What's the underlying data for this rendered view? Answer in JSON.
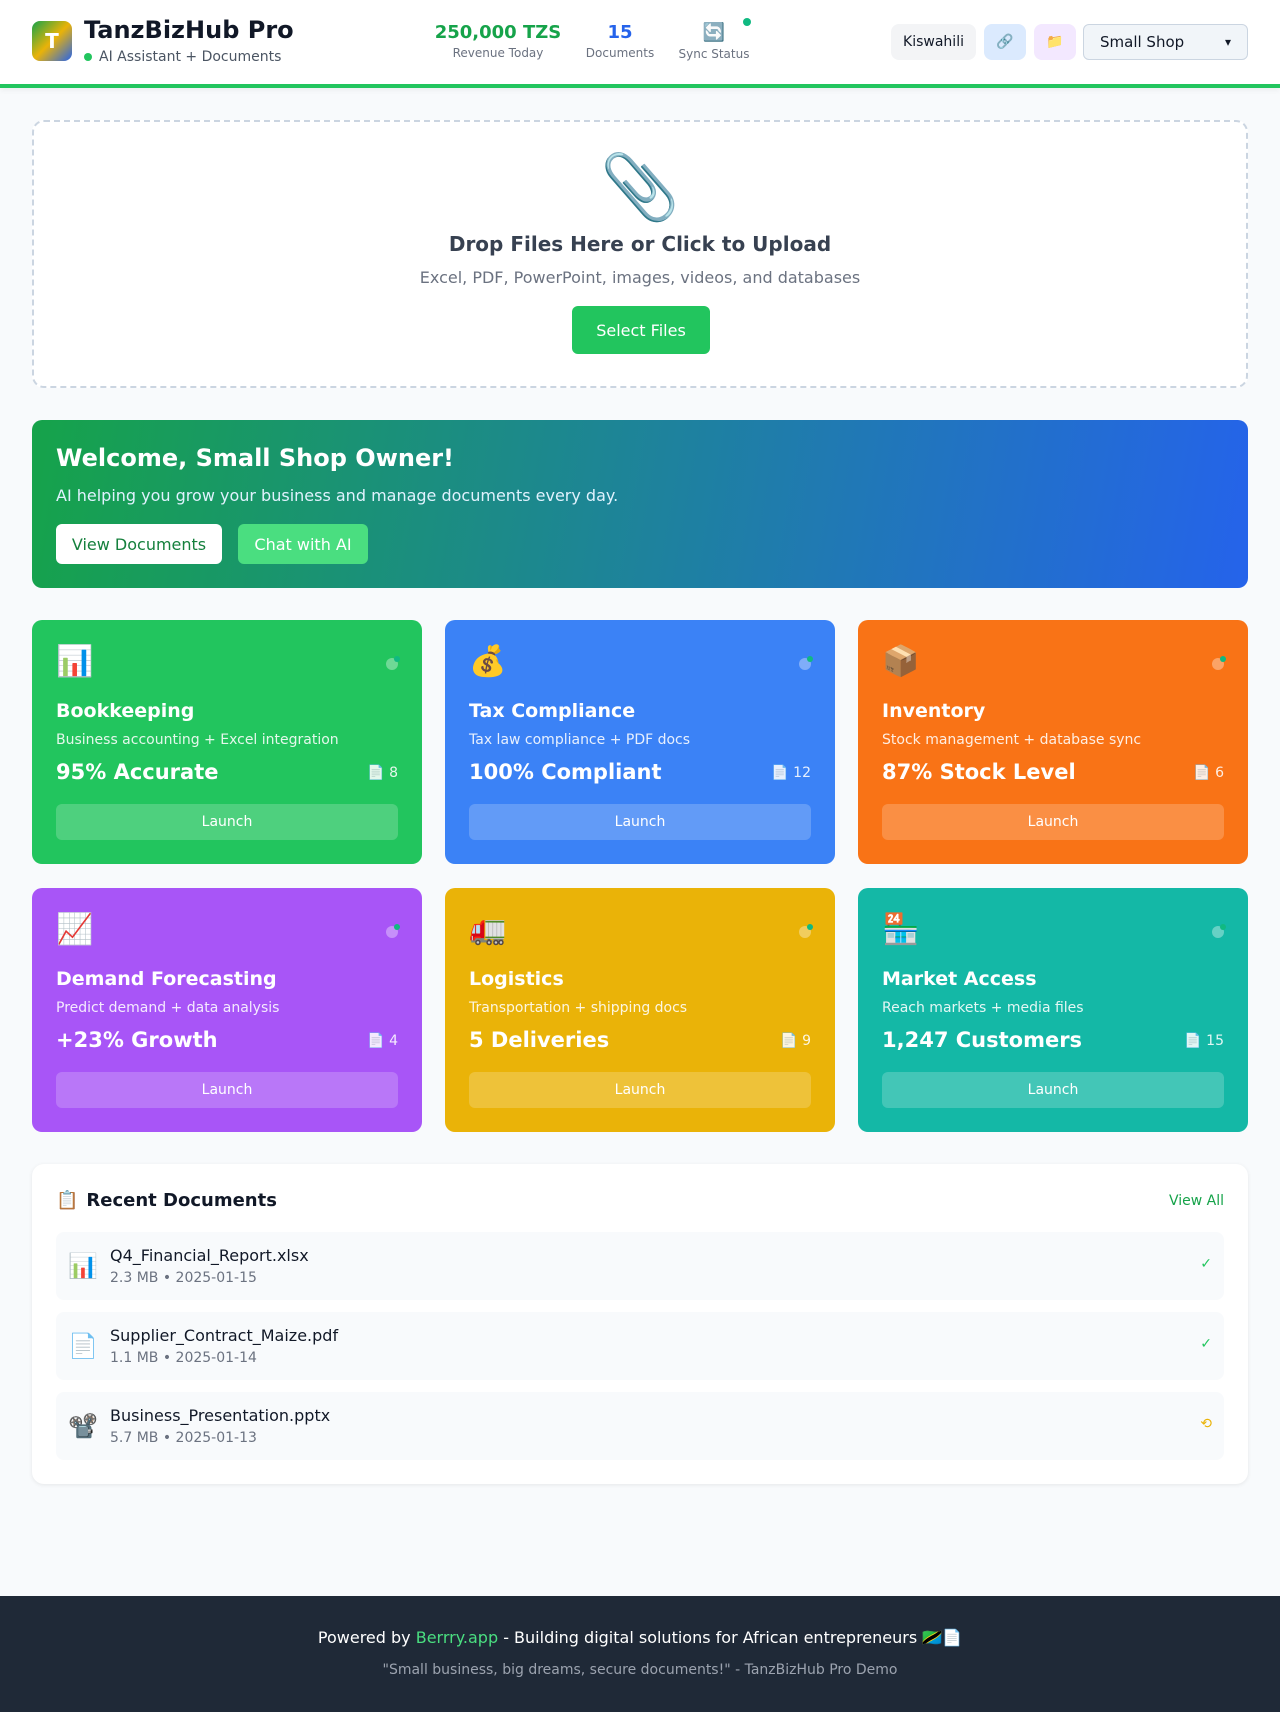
{
  "header": {
    "logo_letter": "T",
    "title": "TanzBizHub Pro",
    "subtitle": "AI Assistant + Documents",
    "stats": {
      "revenue_value": "250,000 TZS",
      "revenue_label": "Revenue Today",
      "documents_value": "15",
      "documents_label": "Documents",
      "sync_icon": "🔄",
      "sync_label": "Sync Status"
    },
    "language_button": "Kiswahili",
    "link_icon": "🔗",
    "folder_icon": "📁",
    "business_type_selected": "Small Shop"
  },
  "upload": {
    "icon": "📎",
    "title": "Drop Files Here or Click to Upload",
    "description": "Excel, PDF, PowerPoint, images, videos, and databases",
    "button": "Select Files"
  },
  "welcome": {
    "title": "Welcome, Small Shop Owner!",
    "description": "AI helping you grow your business and manage documents every day.",
    "primary_button": "View Documents",
    "secondary_button": "Chat with AI"
  },
  "cards": [
    {
      "icon": "📊",
      "title": "Bookkeeping",
      "description": "Business accounting + Excel integration",
      "metric": "95% Accurate",
      "docs": "📄 8",
      "button": "Launch",
      "color": "#22c55e"
    },
    {
      "icon": "💰",
      "title": "Tax Compliance",
      "description": "Tax law compliance + PDF docs",
      "metric": "100% Compliant",
      "docs": "📄 12",
      "button": "Launch",
      "color": "#3b82f6"
    },
    {
      "icon": "📦",
      "title": "Inventory",
      "description": "Stock management + database sync",
      "metric": "87% Stock Level",
      "docs": "📄 6",
      "button": "Launch",
      "color": "#f97316"
    },
    {
      "icon": "📈",
      "title": "Demand Forecasting",
      "description": "Predict demand + data analysis",
      "metric": "+23% Growth",
      "docs": "📄 4",
      "button": "Launch",
      "color": "#a855f7"
    },
    {
      "icon": "🚛",
      "title": "Logistics",
      "description": "Transportation + shipping docs",
      "metric": "5 Deliveries",
      "docs": "📄 9",
      "button": "Launch",
      "color": "#eab308"
    },
    {
      "icon": "🏪",
      "title": "Market Access",
      "description": "Reach markets + media files",
      "metric": "1,247 Customers",
      "docs": "📄 15",
      "button": "Launch",
      "color": "#14b8a6"
    }
  ],
  "recent": {
    "icon": "📋",
    "title": "Recent Documents",
    "view_all": "View All",
    "documents": [
      {
        "icon": "📊",
        "name": "Q4_Financial_Report.xlsx",
        "meta": "2.3 MB • 2025-01-15",
        "status": "✓"
      },
      {
        "icon": "📄",
        "name": "Supplier_Contract_Maize.pdf",
        "meta": "1.1 MB • 2025-01-14",
        "status": "✓"
      },
      {
        "icon": "📽️",
        "name": "Business_Presentation.pptx",
        "meta": "5.7 MB • 2025-01-13",
        "status": "⟲"
      }
    ]
  },
  "footer": {
    "prefix": "Powered by ",
    "brand": "Berrry.app",
    "suffix": " - Building digital solutions for African entrepreneurs 🇹🇿📄",
    "quote": "\"Small business, big dreams, secure documents!\" - TanzBizHub Pro Demo"
  },
  "colors": {
    "accent_green": "#22c55e",
    "accent_blue": "#2563eb",
    "footer_bg": "#1f2937"
  }
}
